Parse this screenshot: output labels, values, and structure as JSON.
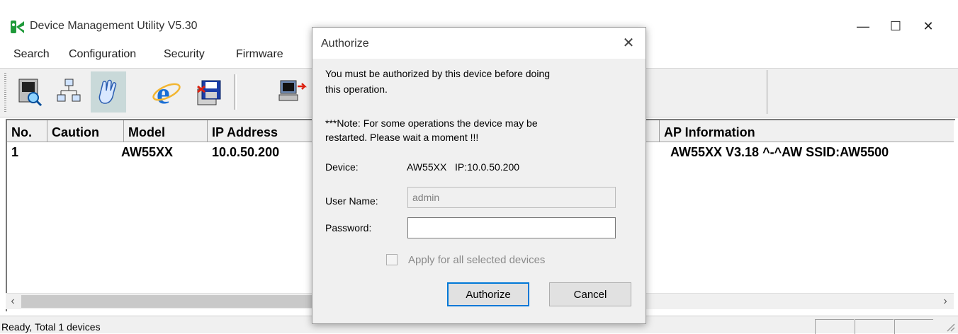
{
  "app": {
    "title": "Device Management Utility V5.30",
    "icon": "app-logo-icon"
  },
  "window_controls": {
    "minimize": "—",
    "maximize": "☐",
    "close": "✕"
  },
  "menu": [
    "Search",
    "Configuration",
    "Security",
    "Firmware"
  ],
  "toolbar": {
    "buttons": [
      "search-device-icon",
      "network-icon",
      "hand-pointer-icon",
      "internet-explorer-icon",
      "save-floppy-icon",
      "computer-upload-icon"
    ]
  },
  "table": {
    "columns": [
      "No.",
      "Caution",
      "Model",
      "IP Address",
      "AP Information"
    ],
    "rows": [
      {
        "no": "1",
        "caution": "",
        "model": "AW55XX",
        "ip": "10.0.50.200",
        "ap_info": "AW55XX V3.18 ^-^AW SSID:AW5500"
      }
    ]
  },
  "scrollbar": {
    "left_arrow": "‹",
    "right_arrow": "›"
  },
  "status": {
    "text": "Ready, Total 1 devices"
  },
  "dialog": {
    "title": "Authorize",
    "close": "✕",
    "message_line1": "You must be authorized by this device before doing",
    "message_line2": "this operation.",
    "note_line1": "***Note: For some operations the device may be",
    "note_line2": "restarted. Please wait a moment !!!",
    "device_label": "Device:",
    "device_value": "AW55XX   IP:10.0.50.200",
    "username_label": "User Name:",
    "username_value": "admin",
    "password_label": "Password:",
    "password_value": "",
    "apply_all_label": "Apply for all selected devices",
    "apply_all_checked": false,
    "authorize_button": "Authorize",
    "cancel_button": "Cancel"
  }
}
